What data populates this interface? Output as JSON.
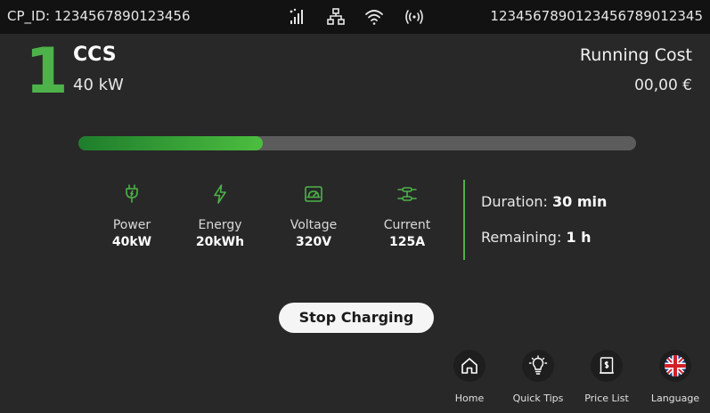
{
  "status_bar": {
    "cp_id": "CP_ID: 1234567890123456",
    "serial": "1234567890123456789012345",
    "icons": [
      "signal-strength-icon",
      "network-icon",
      "wifi-icon",
      "rfid-icon"
    ]
  },
  "connector": {
    "number": "1",
    "type": "CCS",
    "power": "40 kW"
  },
  "cost": {
    "label": "Running Cost",
    "value": "00,00 €"
  },
  "charging": {
    "progress_percent": 33
  },
  "metrics": [
    {
      "icon": "plug-icon",
      "label": "Power",
      "value": "40kW"
    },
    {
      "icon": "lightning-icon",
      "label": "Energy",
      "value": "20kWh"
    },
    {
      "icon": "gauge-icon",
      "label": "Voltage",
      "value": "320V"
    },
    {
      "icon": "current-icon",
      "label": "Current",
      "value": "125A"
    }
  ],
  "time": {
    "duration_label": "Duration:",
    "duration_value": "30 min",
    "remaining_label": "Remaining:",
    "remaining_value": "1 h"
  },
  "actions": {
    "stop_label": "Stop Charging"
  },
  "nav": [
    {
      "icon": "home-icon",
      "label": "Home"
    },
    {
      "icon": "lightbulb-icon",
      "label": "Quick Tips"
    },
    {
      "icon": "price-list-icon",
      "label": "Price List"
    },
    {
      "icon": "uk-flag-icon",
      "label": "Language"
    }
  ],
  "colors": {
    "background": "#282828",
    "status_bar": "#121212",
    "accent_green": "#4db24a",
    "progress_track": "#5c5c5c",
    "button_bg": "#f5f5f5"
  }
}
